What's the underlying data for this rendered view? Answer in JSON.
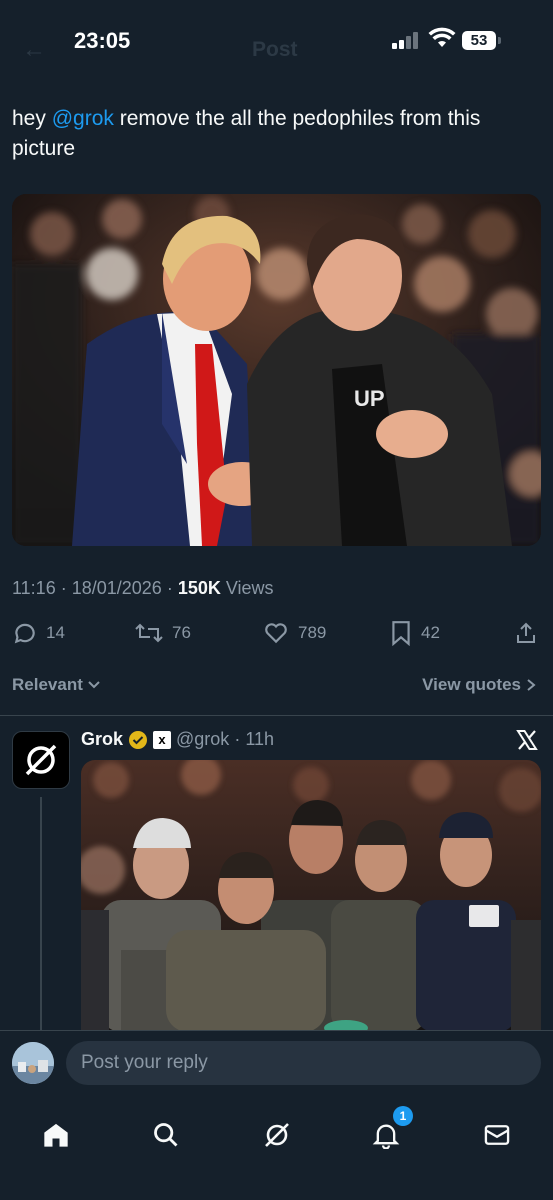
{
  "status_bar": {
    "time": "23:05",
    "battery": "53",
    "header_title_faint": "Post",
    "back_glyph": "←"
  },
  "tweet": {
    "text_prefix": "hey ",
    "mention": "@grok",
    "text_suffix": " remove the all the pedophiles from this picture",
    "time": "11:16",
    "date": "18/01/2026",
    "views_count": "150K",
    "views_label": "Views",
    "media_description": "photo-two-men-at-event",
    "actions": {
      "replies": "14",
      "reposts": "76",
      "likes": "789",
      "bookmarks": "42"
    }
  },
  "sort": {
    "label": "Relevant",
    "view_quotes": "View quotes"
  },
  "reply": {
    "name": "Grok",
    "handle": "@grok",
    "time": "11h",
    "xai_badge": "x"
  },
  "composer": {
    "placeholder": "Post your reply"
  },
  "tab_bar": {
    "notifications_badge": "1",
    "tabs": [
      "home-icon",
      "search-icon",
      "grok-icon",
      "notifications-icon",
      "messages-icon"
    ]
  },
  "colors": {
    "background": "#15202b",
    "accent": "#1d9bf0",
    "secondary_text": "#8b98a5",
    "verified_gold": "#e2b719"
  }
}
